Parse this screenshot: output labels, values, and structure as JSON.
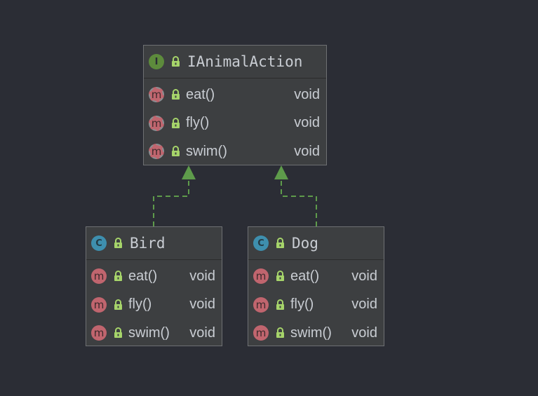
{
  "interface": {
    "kind": "I",
    "name": "IAnimalAction",
    "methods": [
      {
        "name": "eat()",
        "type": "void"
      },
      {
        "name": "fly()",
        "type": "void"
      },
      {
        "name": "swim()",
        "type": "void"
      }
    ]
  },
  "classes": [
    {
      "kind": "C",
      "name": "Bird",
      "methods": [
        {
          "name": "eat()",
          "type": "void"
        },
        {
          "name": "fly()",
          "type": "void"
        },
        {
          "name": "swim()",
          "type": "void"
        }
      ]
    },
    {
      "kind": "C",
      "name": "Dog",
      "methods": [
        {
          "name": "eat()",
          "type": "void"
        },
        {
          "name": "fly()",
          "type": "void"
        },
        {
          "name": "swim()",
          "type": "void"
        }
      ]
    }
  ],
  "method_badge": "m",
  "relations": [
    {
      "from": "Bird",
      "to": "IAnimalAction",
      "type": "realization"
    },
    {
      "from": "Dog",
      "to": "IAnimalAction",
      "type": "realization"
    }
  ],
  "colors": {
    "background": "#2b2d35",
    "box": "#3d3f41",
    "interface_badge": "#5d8b3c",
    "class_badge": "#3e8fae",
    "method_badge": "#c0656e",
    "lock": "#a6d46a",
    "edge": "#5e9b4b"
  }
}
